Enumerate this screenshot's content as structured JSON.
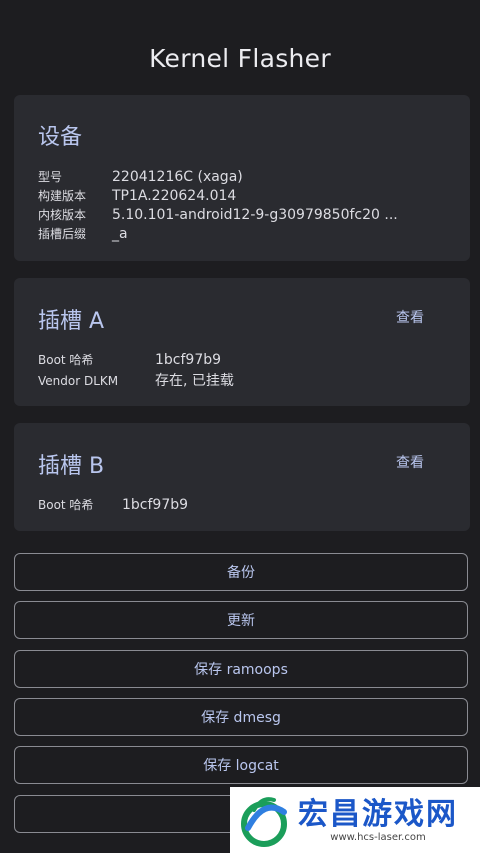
{
  "app": {
    "title": "Kernel Flasher"
  },
  "device_card": {
    "title": "设备",
    "rows": [
      {
        "key": "型号",
        "value": "22041216C (xaga)"
      },
      {
        "key": "构建版本",
        "value": "TP1A.220624.014"
      },
      {
        "key": "内核版本",
        "value": "5.10.101-android12-9-g30979850fc20 ..."
      },
      {
        "key": "插槽后缀",
        "value": "_a"
      }
    ]
  },
  "slot_a_card": {
    "title": "插槽 A",
    "view_label": "查看",
    "rows": [
      {
        "key": "Boot 哈希",
        "value": "1bcf97b9"
      },
      {
        "key": "Vendor DLKM",
        "value": "存在, 已挂载"
      }
    ]
  },
  "slot_b_card": {
    "title": "插槽 B",
    "view_label": "查看",
    "rows": [
      {
        "key": "Boot 哈希",
        "value": "1bcf97b9"
      }
    ]
  },
  "actions": [
    {
      "label": "备份"
    },
    {
      "label": "更新"
    },
    {
      "label": "保存 ramoops"
    },
    {
      "label": "保存 dmesg"
    },
    {
      "label": "保存 logcat"
    },
    {
      "label": ""
    }
  ],
  "watermark": {
    "name": "宏昌游戏网",
    "url": "www.hcs-laser.com"
  },
  "colors": {
    "background": "#1d1d20",
    "card": "#2a2b30",
    "accent": "#b9c6ee",
    "outline": "#8a8b92"
  }
}
